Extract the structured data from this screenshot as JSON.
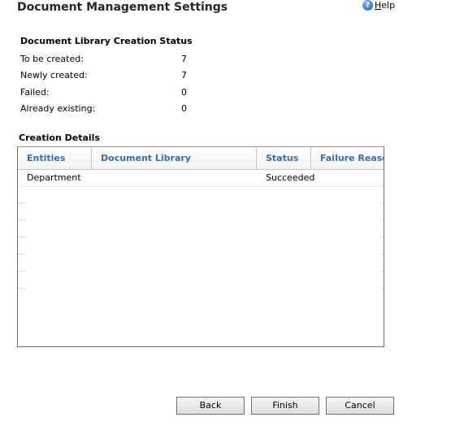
{
  "header": {
    "title": "Document Management Settings",
    "help_label": "Help",
    "help_icon": "help-question-icon"
  },
  "status_section": {
    "heading": "Document Library Creation Status",
    "rows": [
      {
        "label": "To be created:",
        "value": "7"
      },
      {
        "label": "Newly created:",
        "value": "7"
      },
      {
        "label": "Failed:",
        "value": "0"
      },
      {
        "label": "Already existing:",
        "value": "0"
      }
    ]
  },
  "details_section": {
    "heading": "Creation Details",
    "columns": [
      "Entities",
      "Document Library",
      "Status",
      "Failure Reason"
    ],
    "rows": [
      {
        "entity": "Department",
        "document_library": "",
        "status": "Succeeded",
        "failure_reason": ""
      }
    ]
  },
  "buttons": {
    "back": "Back",
    "finish": "Finish",
    "cancel": "Cancel"
  },
  "colors": {
    "column_header_text": "#3e6aa8",
    "help_icon": "#1e5fb3"
  }
}
